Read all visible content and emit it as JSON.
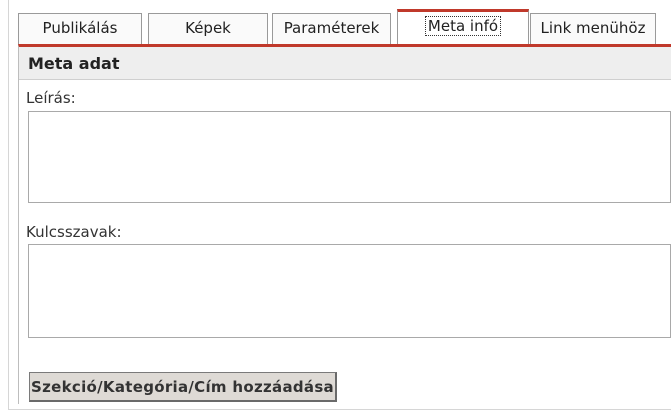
{
  "tabs": [
    {
      "label": "Publikálás",
      "active": false
    },
    {
      "label": "Képek",
      "active": false
    },
    {
      "label": "Paraméterek",
      "active": false
    },
    {
      "label": "Meta infó",
      "active": true
    },
    {
      "label": "Link menühöz",
      "active": false
    }
  ],
  "panel": {
    "title": "Meta adat",
    "description_label": "Leírás:",
    "description_value": "",
    "keywords_label": "Kulcsszavak:",
    "keywords_value": "",
    "add_button_label": "Szekció/Kategória/Cím hozzáadása"
  },
  "colors": {
    "active_tab_accent": "#c0392b",
    "panel_header_bg": "#eeeeee",
    "button_bg": "#dedad5"
  }
}
